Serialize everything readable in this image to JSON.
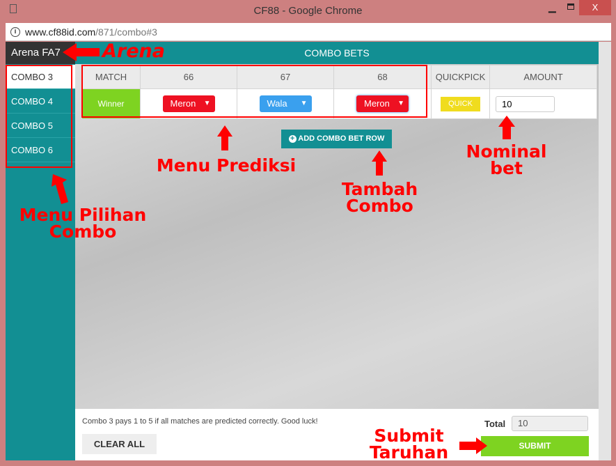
{
  "window": {
    "title": "CF88 - Google Chrome",
    "close": "X"
  },
  "address": {
    "host": "www.cf88id.com",
    "path": "/871/combo#3"
  },
  "sidebar": {
    "arena": "Arena FA7",
    "items": [
      {
        "label": "COMBO 3",
        "active": true
      },
      {
        "label": "COMBO 4"
      },
      {
        "label": "COMBO 5"
      },
      {
        "label": "COMBO 6"
      }
    ]
  },
  "main": {
    "title": "COMBO BETS",
    "table": {
      "headers": [
        "MATCH",
        "66",
        "67",
        "68",
        "QUICKPICK",
        "AMOUNT"
      ],
      "row": {
        "match": "Winner",
        "picks": [
          "Meron",
          "Wala",
          "Meron"
        ],
        "quick": "QUICK",
        "amount": "10"
      }
    },
    "add_row": "ADD COMBO BET ROW"
  },
  "footer": {
    "note": "Combo 3 pays 1 to 5 if all matches are predicted correctly. Good luck!",
    "clear": "CLEAR ALL",
    "total_label": "Total",
    "total": "10",
    "submit": "SUBMIT"
  },
  "annotations": {
    "arena": "Arena",
    "menu_prediksi": "Menu Prediksi",
    "tambah": "Tambah Combo",
    "nominal": "Nominal bet",
    "menu_combo": "Menu Pilihan Combo",
    "submit": "Submit Taruhan"
  },
  "colors": {
    "teal": "#128f93",
    "green": "#7ed321",
    "red": "#ee1122",
    "blue": "#3aa0ee",
    "yellow": "#f0dc1e"
  }
}
